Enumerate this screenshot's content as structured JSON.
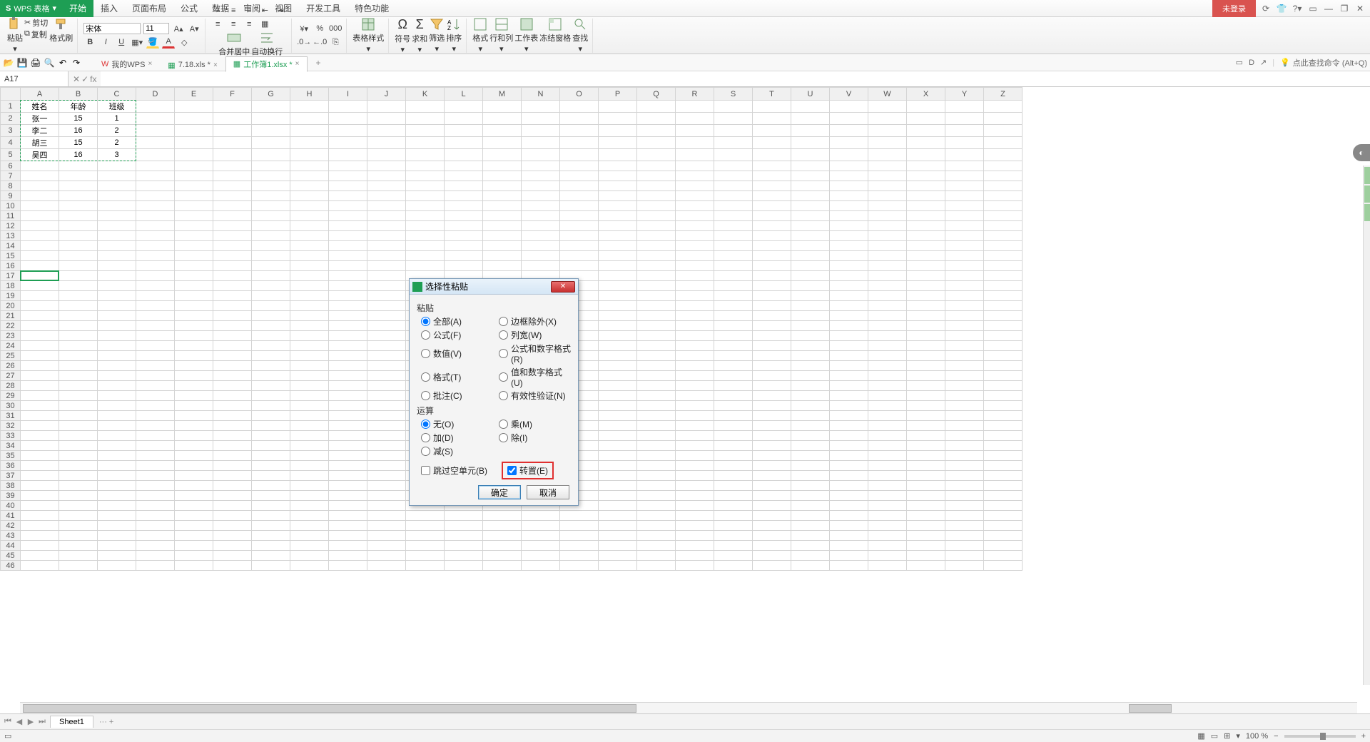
{
  "app": {
    "name": "WPS 表格"
  },
  "menu": {
    "tabs": [
      "开始",
      "插入",
      "页面布局",
      "公式",
      "数据",
      "审阅",
      "视图",
      "开发工具",
      "特色功能"
    ],
    "active": 0
  },
  "titleRight": {
    "login": "未登录"
  },
  "ribbon": {
    "paste": "粘贴",
    "cut": "剪切",
    "copy": "复制",
    "formatPainter": "格式刷",
    "fontName": "宋体",
    "fontSize": "11",
    "mergeCenter": "合并居中",
    "autoWrap": "自动换行",
    "tableStyle": "表格样式",
    "symbol": "符号",
    "sum": "求和",
    "filter": "筛选",
    "sort": "排序",
    "format": "格式",
    "rowCol": "行和列",
    "worksheet": "工作表",
    "freezePane": "冻结窗格",
    "find": "查找"
  },
  "qat": {
    "items": [
      "open",
      "save",
      "print",
      "preview",
      "undo",
      "redo"
    ]
  },
  "docTabs": {
    "tabs": [
      {
        "icon": "wps",
        "label": "我的WPS",
        "active": false
      },
      {
        "icon": "xls",
        "label": "7.18.xls *",
        "active": false
      },
      {
        "icon": "xls",
        "label": "工作簿1.xlsx *",
        "active": true
      }
    ]
  },
  "searchHint": "点此查找命令 (Alt+Q)",
  "formulaBar": {
    "nameBox": "A17",
    "fx": "fx"
  },
  "columns": [
    "A",
    "B",
    "C",
    "D",
    "E",
    "F",
    "G",
    "H",
    "I",
    "J",
    "K",
    "L",
    "M",
    "N",
    "O",
    "P",
    "Q",
    "R",
    "S",
    "T",
    "U",
    "V",
    "W",
    "X",
    "Y",
    "Z"
  ],
  "rowCount": 46,
  "data": {
    "1": {
      "A": "姓名",
      "B": "年龄",
      "C": "班级"
    },
    "2": {
      "A": "张一",
      "B": "15",
      "C": "1"
    },
    "3": {
      "A": "李二",
      "B": "16",
      "C": "2"
    },
    "4": {
      "A": "胡三",
      "B": "15",
      "C": "2"
    },
    "5": {
      "A": "吴四",
      "B": "16",
      "C": "3"
    }
  },
  "marquee": {
    "top": 0,
    "left": 0,
    "rows": 5,
    "cols": 3
  },
  "activeCell": {
    "row": 17,
    "col": "A"
  },
  "sheetTabs": {
    "active": "Sheet1"
  },
  "status": {
    "zoom": "100 %"
  },
  "dialog": {
    "title": "选择性粘贴",
    "groupPaste": "粘贴",
    "pasteOptions": [
      [
        "全部(A)",
        "边框除外(X)"
      ],
      [
        "公式(F)",
        "列宽(W)"
      ],
      [
        "数值(V)",
        "公式和数字格式(R)"
      ],
      [
        "格式(T)",
        "值和数字格式(U)"
      ],
      [
        "批注(C)",
        "有效性验证(N)"
      ]
    ],
    "pasteSelected": "全部(A)",
    "groupOp": "运算",
    "opOptions": [
      [
        "无(O)",
        "乘(M)"
      ],
      [
        "加(D)",
        "除(I)"
      ],
      [
        "减(S)",
        ""
      ]
    ],
    "opSelected": "无(O)",
    "skipBlanks": "跳过空单元(B)",
    "transpose": "转置(E)",
    "ok": "确定",
    "cancel": "取消"
  }
}
